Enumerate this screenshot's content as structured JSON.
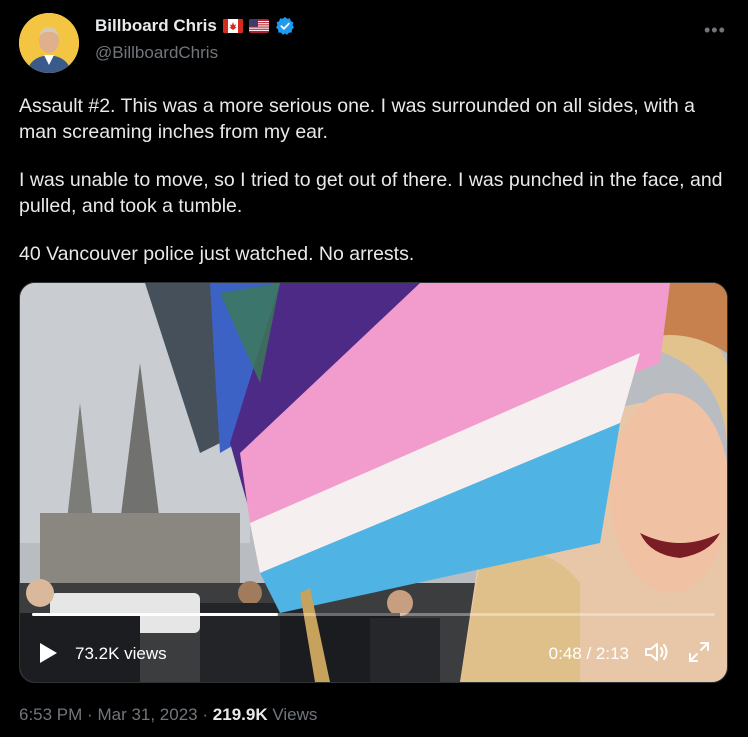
{
  "author": {
    "display_name": "Billboard Chris",
    "handle": "@BillboardChris",
    "flags": [
      "canada-flag",
      "usa-flag"
    ],
    "verified": true
  },
  "tweet": {
    "paragraphs": [
      "Assault #2. This was a more serious one. I was surrounded on all sides, with a man screaming inches from my ear.",
      "I was unable to move, so I tried to get out of there. I was punched in the face, and pulled, and took a tumble.",
      "40 Vancouver police just watched. No arrests."
    ]
  },
  "video": {
    "views": "73.2K views",
    "time": "0:48 / 2:13",
    "progress_fraction": 0.36
  },
  "meta": {
    "time": "6:53 PM",
    "separator": "·",
    "date": "Mar 31, 2023",
    "view_count": "219.9K",
    "views_label": "Views"
  },
  "colors": {
    "background": "#000000",
    "text_primary": "#e7e9ea",
    "text_secondary": "#71767b",
    "verified_blue": "#1d9bf0"
  }
}
